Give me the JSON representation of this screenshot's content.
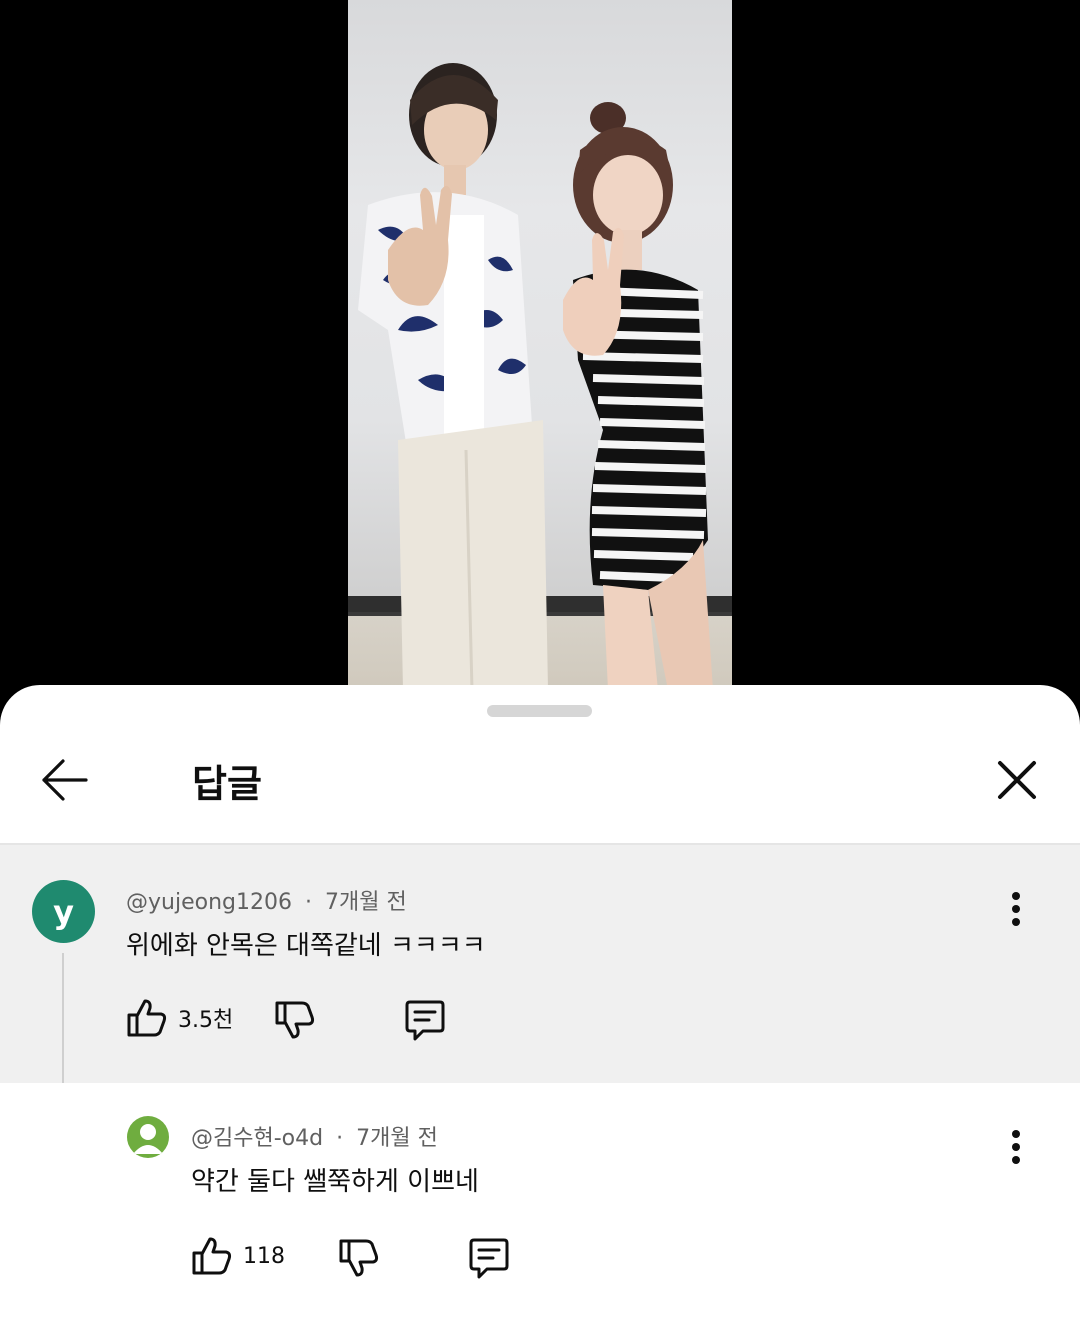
{
  "sheet": {
    "title": "답글"
  },
  "parent_comment": {
    "avatar_letter": "y",
    "avatar_color": "#1f8a6f",
    "author": "@yujeong1206",
    "separator": "·",
    "time": "7개월 전",
    "text": "위에화 안목은 대쪽같네 ㅋㅋㅋㅋ",
    "likes": "3.5천"
  },
  "reply_comment": {
    "avatar_color": "#6fad3f",
    "author": "@김수현-o4d",
    "separator": "·",
    "time": "7개월 전",
    "text": "약간 둘다 쌜쭉하게 이쁘네",
    "likes": "118"
  },
  "icons": {
    "back": "arrow-left-icon",
    "close": "close-icon",
    "like": "thumbs-up-icon",
    "dislike": "thumbs-down-icon",
    "reply": "comment-icon",
    "more": "more-vertical-icon"
  }
}
